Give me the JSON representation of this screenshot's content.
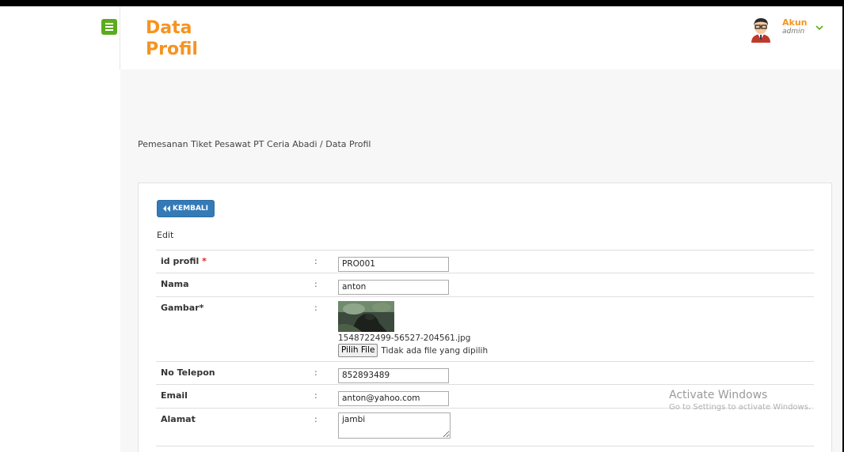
{
  "header": {
    "title": "Data Profil",
    "account": {
      "name": "Akun",
      "role": "admin"
    }
  },
  "breadcrumb": "Pemesanan Tiket Pesawat PT Ceria Abadi / Data Profil",
  "card": {
    "back_label": "KEMBALI",
    "mode_label": "Edit",
    "fields": {
      "id_profil": {
        "label": "id profil",
        "required_mark": "*",
        "value": "PRO001"
      },
      "nama": {
        "label": "Nama",
        "value": "anton"
      },
      "gambar": {
        "label": "Gambar*",
        "filename": "1548722499-56527-204561.jpg",
        "choose_label": "Pilih File",
        "status": "Tidak ada file yang dipilih"
      },
      "telepon": {
        "label": "No Telepon",
        "value": "852893489"
      },
      "email": {
        "label": "Email",
        "value": "anton@yahoo.com"
      },
      "alamat": {
        "label": "Alamat",
        "value": "jambi"
      }
    },
    "colon": ":"
  },
  "watermark": {
    "title": "Activate Windows",
    "subtitle": "Go to Settings to activate Windows."
  },
  "colors": {
    "accent": "#f7931e",
    "menu_button": "#5cab1e",
    "primary_button": "#337ab7",
    "required": "#e02020"
  }
}
